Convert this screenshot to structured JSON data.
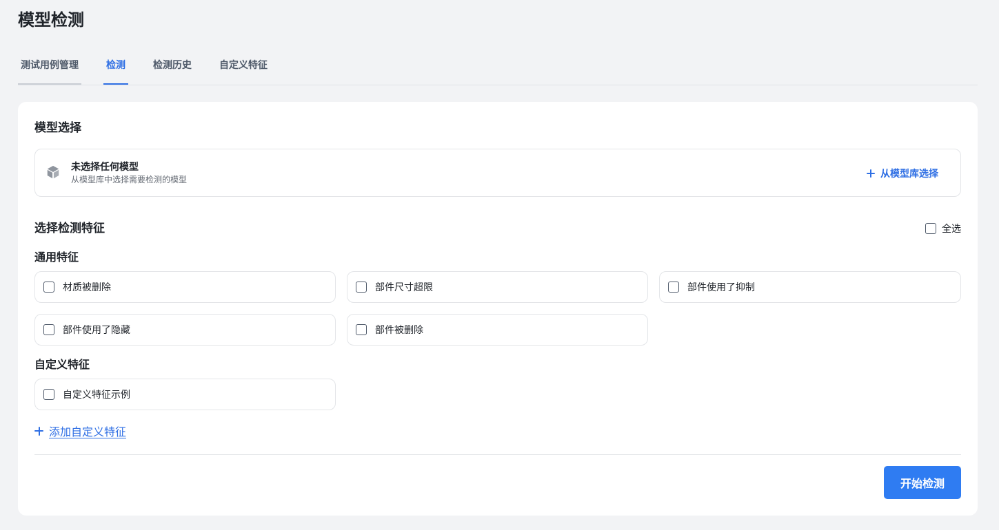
{
  "page": {
    "title": "模型检测"
  },
  "tabs": [
    {
      "label": "测试用例管理"
    },
    {
      "label": "检测"
    },
    {
      "label": "检测历史"
    },
    {
      "label": "自定义特征"
    }
  ],
  "active_tab": "检测",
  "model_section": {
    "title": "模型选择",
    "empty_title": "未选择任何模型",
    "empty_desc": "从模型库中选择需要检测的模型",
    "choose_label": "从模型库选择"
  },
  "features_section": {
    "title": "选择检测特征",
    "select_all_label": "全选",
    "general_group_title": "通用特征",
    "general": [
      {
        "label": "材质被删除",
        "checked": false
      },
      {
        "label": "部件尺寸超限",
        "checked": false
      },
      {
        "label": "部件使用了抑制",
        "checked": false
      },
      {
        "label": "部件使用了隐藏",
        "checked": false
      },
      {
        "label": "部件被删除",
        "checked": false
      }
    ],
    "custom_group_title": "自定义特征",
    "custom": [
      {
        "label": "自定义特征示例",
        "checked": false
      }
    ],
    "add_custom_label": "添加自定义特征"
  },
  "actions": {
    "start_label": "开始检测"
  },
  "colors": {
    "accent": "#2f6fe4",
    "primary_button": "#2f7cf2",
    "background": "#f2f3f5"
  }
}
